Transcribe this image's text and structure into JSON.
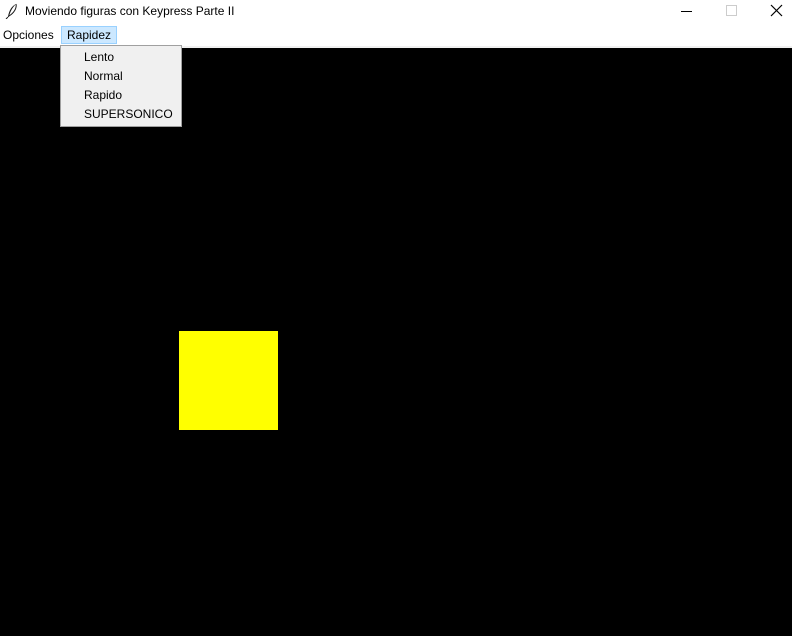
{
  "window": {
    "title": "Moviendo figuras con Keypress Parte II",
    "app_icon": "feather-icon",
    "controls": {
      "minimize_icon": "minimize-icon",
      "maximize_icon": "maximize-icon",
      "close_icon": "close-icon"
    }
  },
  "menubar": {
    "items": [
      {
        "label": "Opciones"
      },
      {
        "label": "Rapidez",
        "state": "open"
      }
    ]
  },
  "speed_menu": {
    "items": [
      {
        "label": "Lento"
      },
      {
        "label": "Normal"
      },
      {
        "label": "Rapido"
      },
      {
        "label": "SUPERSONICO"
      }
    ]
  },
  "canvas": {
    "background": "#000000",
    "shape": {
      "kind": "square",
      "color": "#ffff00"
    }
  },
  "colors": {
    "menu_highlight": "#cce8ff",
    "menu_highlight_border": "#99d1ff",
    "dropdown_bg": "#f0f0f0"
  }
}
